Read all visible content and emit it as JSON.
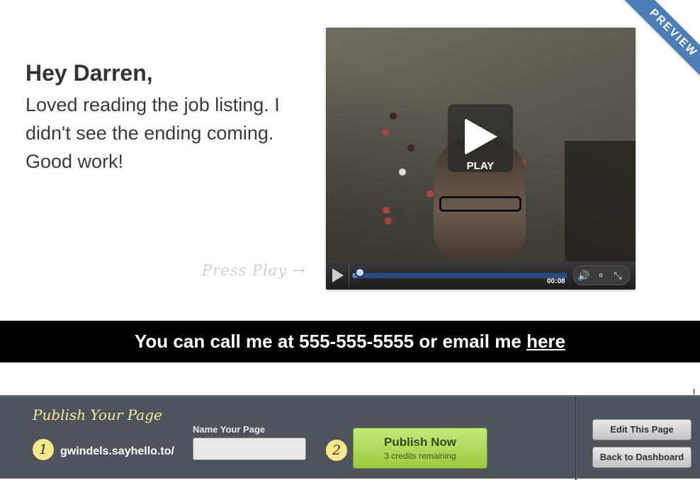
{
  "ribbon": {
    "label": "PREVIEW"
  },
  "greeting": {
    "title": "Hey Darren,",
    "message": "Loved reading the job listing. I didn't see the ending coming. Good work!"
  },
  "video": {
    "play_label": "PLAY",
    "time": "00:08",
    "progress": 0.03,
    "hint": "Press Play →"
  },
  "contact": {
    "text": "You can call me at 555-555-5555 or email me ",
    "link": "here"
  },
  "publish": {
    "title": "Publish Your Page",
    "step1": "1",
    "step2": "2",
    "domain": "gwindels.sayhello.to/",
    "name_label": "Name Your Page",
    "name_value": "",
    "button_label": "Publish Now",
    "credits": "3 credits remaining"
  },
  "actions": {
    "edit": "Edit This Page",
    "dashboard": "Back to Dashboard"
  },
  "colors": {
    "ribbon": "#4c7fb8",
    "band": "#000000",
    "bar": "#4f545c",
    "publish": "#9acb3e",
    "accent_yellow": "#f6e98a"
  }
}
